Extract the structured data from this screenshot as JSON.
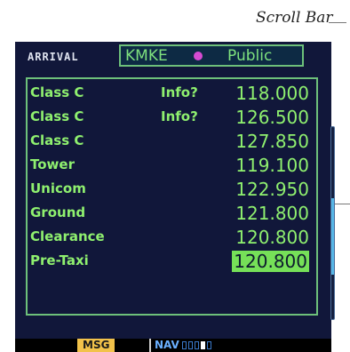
{
  "callout": {
    "label": "Scroll Bar"
  },
  "header": {
    "page_title": "ARRIVAL",
    "airport_id": "KMKE",
    "airport_type": "Public"
  },
  "frequencies": [
    {
      "type": "Class C",
      "info": "Info?",
      "freq": "118.000"
    },
    {
      "type": "Class C",
      "info": "Info?",
      "freq": "126.500"
    },
    {
      "type": "Class C",
      "info": "",
      "freq": "127.850"
    },
    {
      "type": "Tower",
      "info": "",
      "freq": "119.100"
    },
    {
      "type": "Unicom",
      "info": "",
      "freq": "122.950"
    },
    {
      "type": "Ground",
      "info": "",
      "freq": "121.800"
    },
    {
      "type": "Clearance",
      "info": "",
      "freq": "120.800"
    },
    {
      "type": "Pre-Taxi",
      "info": "",
      "freq": "120.800",
      "selected": true
    }
  ],
  "scrollbar": {
    "position_fraction": 0.37,
    "visible_fraction": 0.4
  },
  "status_bar": {
    "msg_label": "MSG",
    "nav_label": "NAV",
    "page_count": 5,
    "active_page": 4
  },
  "colors": {
    "screen_bg": "#11173a",
    "text_green": "#8ff06f",
    "selection_bg": "#76e058",
    "msg_bg": "#f2c24a",
    "nav_blue": "#6ab0ff",
    "waypoint_magenta": "#d64bd2"
  }
}
